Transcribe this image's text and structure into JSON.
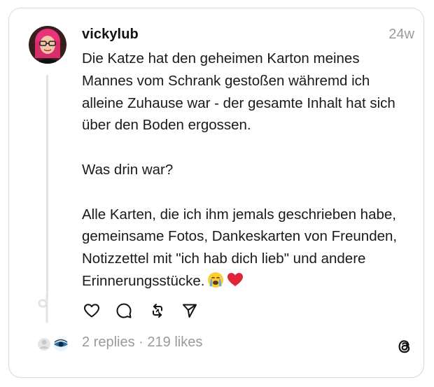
{
  "post": {
    "username": "vickylub",
    "timestamp": "24w",
    "paragraphs": [
      "Die Katze hat den geheimen Karton meines Mannes vom Schrank gestoßen währemd ich alleine Zuhause war - der gesamte Inhalt hat sich über den Boden ergossen.",
      "Was drin war?",
      "Alle Karten, die ich ihm jemals geschrieben habe, gemeinsame Fotos, Dankeskarten von Freunden, Notizzettel mit \"ich hab dich lieb\" und andere Erinnerungsstücke."
    ],
    "emojis": [
      "crying-face-emoji",
      "red-heart-emoji"
    ]
  },
  "actions": {
    "icons": [
      "heart-icon",
      "comment-icon",
      "repost-icon",
      "share-icon"
    ]
  },
  "stats": {
    "replies": "2 replies",
    "separator": " · ",
    "likes": "219 likes"
  },
  "brand": {
    "logo": "threads-logo-icon"
  },
  "colors": {
    "text": "#1a1a1a",
    "muted": "#9a9a9a",
    "border": "#d9d9d9",
    "thread_line": "#e3e3e3",
    "heart": "#e0243a",
    "avatar_hair": "#e8337a"
  }
}
